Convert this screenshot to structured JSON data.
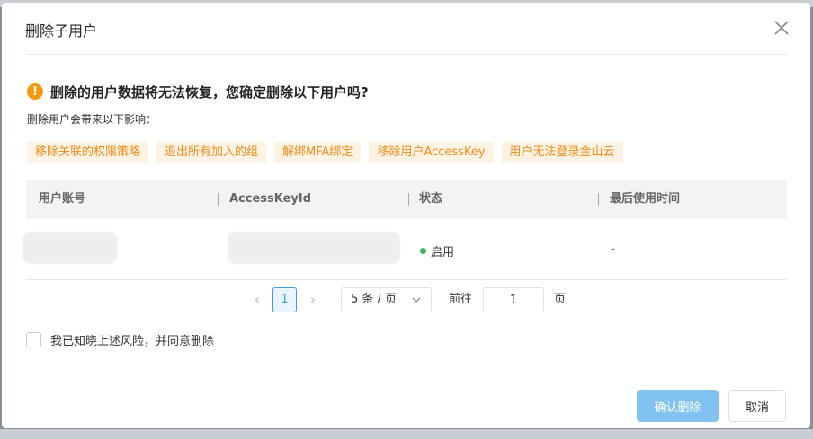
{
  "dialog": {
    "title": "删除子用户",
    "close_icon": "close-icon"
  },
  "warning": {
    "icon": "warning-icon",
    "icon_glyph": "!",
    "message": "删除的用户数据将无法恢复，您确定删除以下用户吗?",
    "impact_title": "删除用户会带来以下影响："
  },
  "impacts": [
    "移除关联的权限策略",
    "退出所有加入的组",
    "解绑MFA绑定",
    "移除用户AccessKey",
    "用户无法登录金山云"
  ],
  "table": {
    "columns": [
      "用户账号",
      "AccessKeyId",
      "状态",
      "最后使用时间"
    ],
    "rows": [
      {
        "status": "启用",
        "last_used": "-"
      }
    ]
  },
  "pagination": {
    "current_page": "1",
    "page_size": "5 条 / 页",
    "goto_label": "前往",
    "goto_value": "1",
    "page_label": "页",
    "prev_glyph": "‹",
    "next_glyph": "›"
  },
  "agreement": {
    "label": "我已知晓上述风险，并同意删除",
    "checked": false
  },
  "footer": {
    "confirm_label": "确认删除",
    "cancel_label": "取消"
  },
  "colors": {
    "accent": "#3f9be0",
    "warning": "#f59a10",
    "tag_text": "#f08c1a",
    "tag_bg": "#fdf3e5",
    "status_ok": "#3fb35a",
    "confirm_disabled": "#82c2f0"
  }
}
